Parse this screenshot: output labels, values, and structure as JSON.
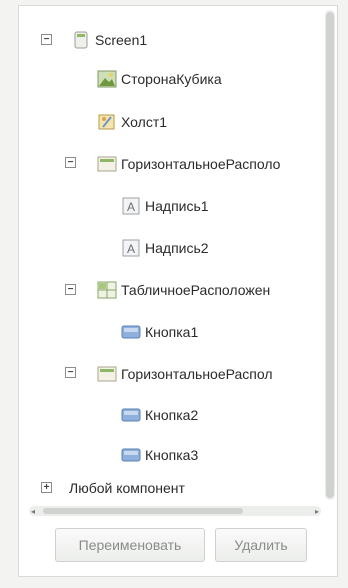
{
  "tree": {
    "screen": {
      "label": "Screen1",
      "toggle": "−"
    },
    "image1": {
      "label": "СторонаКубика"
    },
    "canvas1": {
      "label": "Холст1"
    },
    "hbox1": {
      "label": "ГоризонтальноеРасполо",
      "toggle": "−"
    },
    "label1": {
      "label": "Надпись1"
    },
    "label2": {
      "label": "Надпись2"
    },
    "table1": {
      "label": "ТабличноеРасположен",
      "toggle": "−"
    },
    "button1": {
      "label": "Кнопка1"
    },
    "hbox2": {
      "label": "ГоризонтальноеРаспол",
      "toggle": "−"
    },
    "button2": {
      "label": "Кнопка2"
    },
    "button3": {
      "label": "Кнопка3"
    },
    "any": {
      "label": "Любой компонент",
      "toggle": "+"
    }
  },
  "buttons": {
    "rename": "Переименовать",
    "delete": "Удалить"
  },
  "colors": {
    "panel_bg": "#ffffff",
    "icon_green": "#7fb04a",
    "icon_blue": "#6c95c9"
  }
}
